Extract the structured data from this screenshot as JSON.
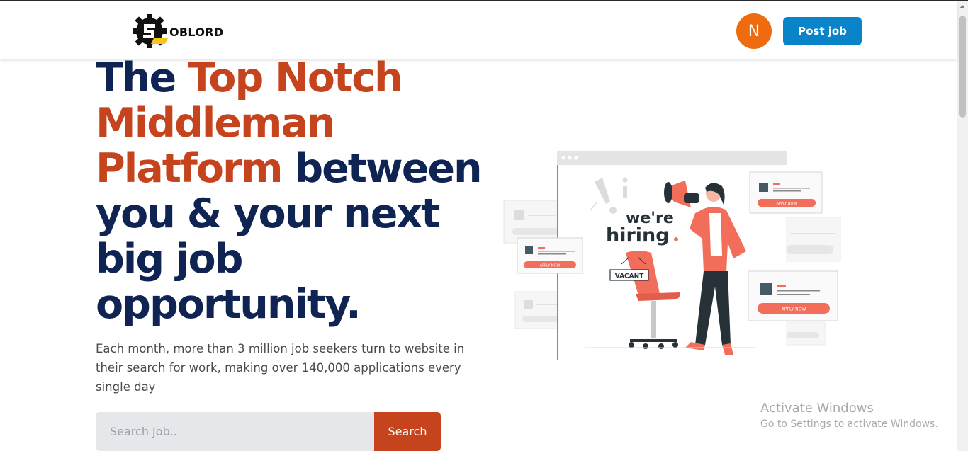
{
  "brand": {
    "logo_text": "OBLORD"
  },
  "header": {
    "avatar_initial": "N",
    "post_job_label": "Post job"
  },
  "hero": {
    "title_part1": "The ",
    "title_accent": "Top Notch Middleman Platform",
    "title_part2": " between you & your next big job opportunity.",
    "subtitle": "Each month, more than 3 million job seekers turn to website in their search for work, making over 140,000 applications every single day"
  },
  "search": {
    "placeholder": "Search Job..",
    "value": "",
    "button_label": "Search"
  },
  "illustration": {
    "hiring_line1": "we're",
    "hiring_line2": "hiring",
    "vacant_sign": "VACANT",
    "apply_label": "APPLY NOW"
  },
  "watermark": {
    "title": "Activate Windows",
    "subtitle": "Go to Settings to activate Windows."
  },
  "colors": {
    "navy": "#0f2452",
    "accent": "#c5441d",
    "button_blue": "#0a84c9",
    "avatar_orange": "#ee6c0f",
    "coral": "#f26e5b"
  }
}
